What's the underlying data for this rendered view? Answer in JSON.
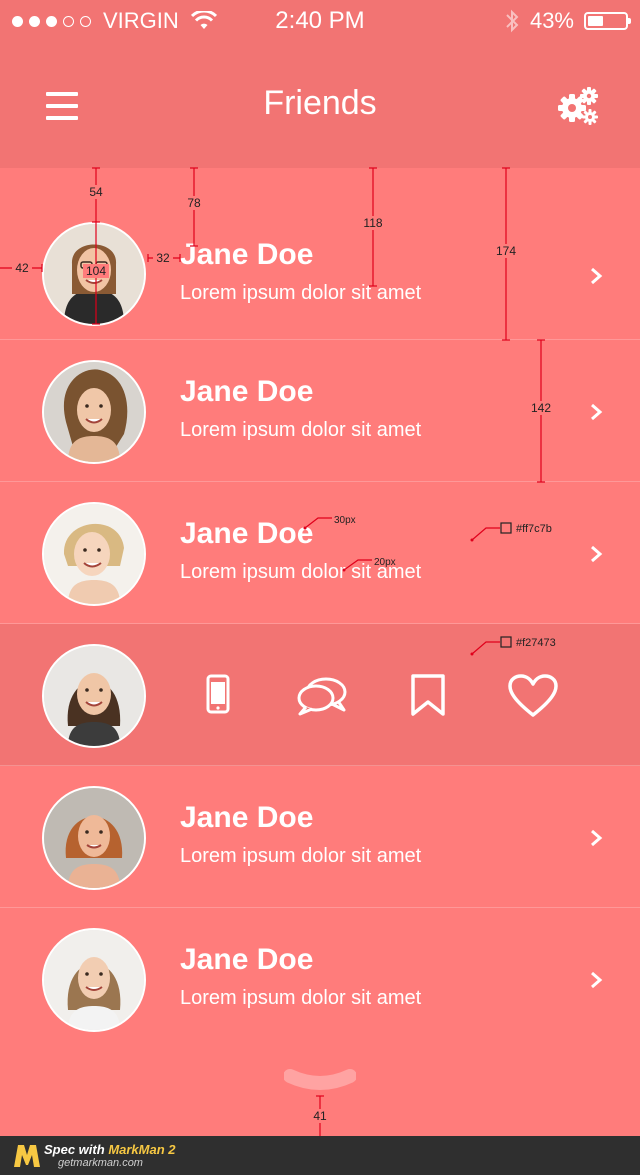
{
  "status_bar": {
    "carrier": "VIRGIN",
    "signal": {
      "filled": 3,
      "total": 5
    },
    "time": "2:40 PM",
    "battery_text": "43%",
    "battery_level": 0.43
  },
  "nav": {
    "title": "Friends",
    "left_icon": "menu-icon",
    "right_icon": "settings-gears-icon"
  },
  "friends": [
    {
      "name": "Jane Doe",
      "subtitle": "Lorem ipsum dolor sit amet"
    },
    {
      "name": "Jane Doe",
      "subtitle": "Lorem ipsum dolor sit amet"
    },
    {
      "name": "Jane Doe",
      "subtitle": "Lorem ipsum dolor sit amet"
    },
    {
      "name": "",
      "subtitle": "",
      "actions": [
        "phone-icon",
        "chat-icon",
        "bookmark-icon",
        "heart-icon"
      ]
    },
    {
      "name": "Jane Doe",
      "subtitle": "Lorem ipsum dolor sit amet"
    },
    {
      "name": "Jane Doe",
      "subtitle": "Lorem ipsum dolor sit amet"
    }
  ],
  "spec_annotations": {
    "measurements": [
      "54",
      "78",
      "118",
      "174",
      "42",
      "104",
      "32",
      "142",
      "41"
    ],
    "font_sizes": [
      "30px",
      "20px"
    ],
    "colors": [
      "#ff7c7b",
      "#f27473"
    ]
  },
  "footer": {
    "spec_prefix": "Spec with",
    "brand": "MarkMan 2",
    "domain": "getmarkman.com"
  },
  "colors": {
    "background": "#ff7c7b",
    "header": "#f27473",
    "text": "#ffffff",
    "spec_line": "#e0001b"
  }
}
